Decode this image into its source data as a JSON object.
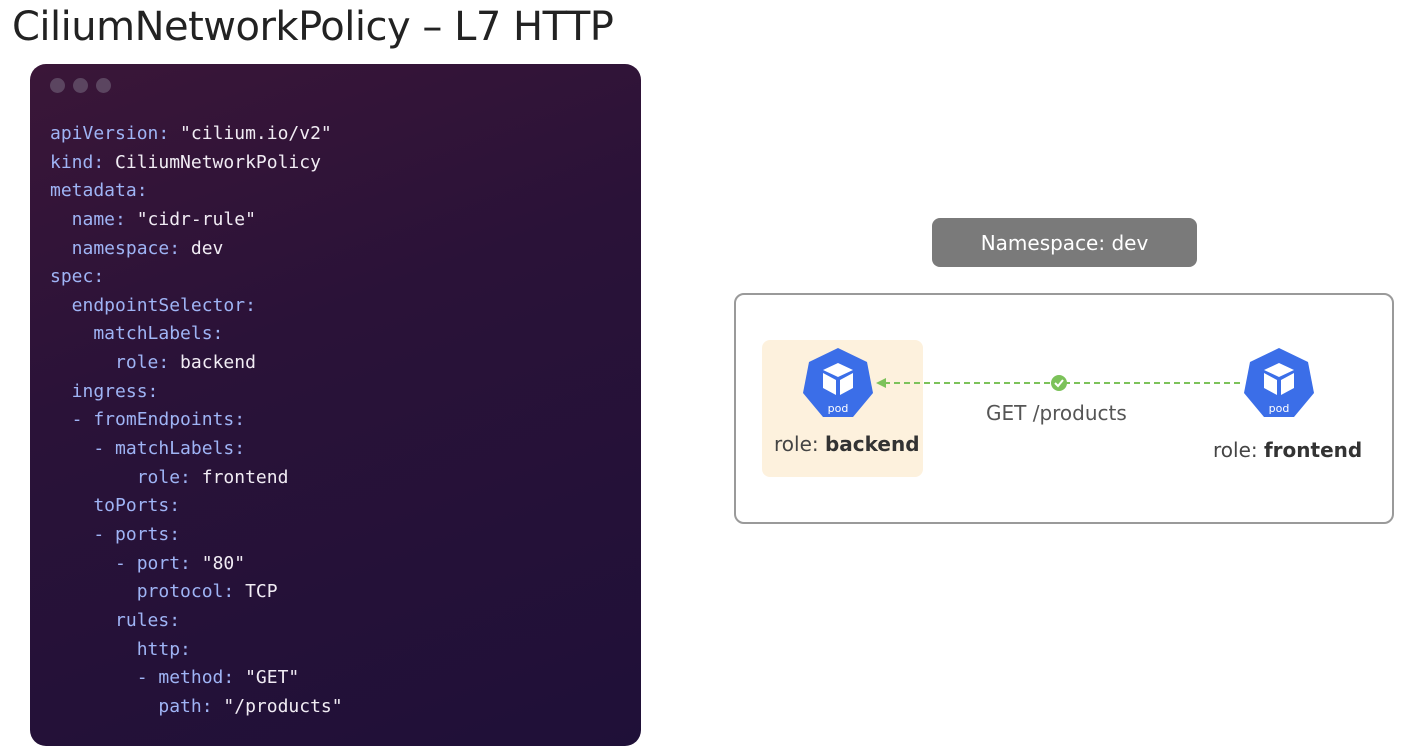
{
  "slide": {
    "title": "CiliumNetworkPolicy – L7 HTTP"
  },
  "code_window": {
    "lines": [
      {
        "key": "apiVersion:",
        "value": " \"cilium.io/v2\""
      },
      {
        "key": "kind:",
        "value": " CiliumNetworkPolicy"
      },
      {
        "key": "metadata:",
        "value": ""
      },
      {
        "key": "  name:",
        "value": " \"cidr-rule\""
      },
      {
        "key": "  namespace:",
        "value": " dev"
      },
      {
        "key": "spec:",
        "value": ""
      },
      {
        "key": "  endpointSelector:",
        "value": ""
      },
      {
        "key": "    matchLabels:",
        "value": ""
      },
      {
        "key": "      role:",
        "value": " backend"
      },
      {
        "key": "  ingress:",
        "value": ""
      },
      {
        "key": "  - fromEndpoints:",
        "value": ""
      },
      {
        "key": "    - matchLabels:",
        "value": ""
      },
      {
        "key": "        role:",
        "value": " frontend"
      },
      {
        "key": "    toPorts:",
        "value": ""
      },
      {
        "key": "    - ports:",
        "value": ""
      },
      {
        "key": "      - port:",
        "value": " \"80\""
      },
      {
        "key": "        protocol:",
        "value": " TCP"
      },
      {
        "key": "      rules:",
        "value": ""
      },
      {
        "key": "        http:",
        "value": ""
      },
      {
        "key": "        - method:",
        "value": " \"GET\""
      },
      {
        "key": "          path:",
        "value": " \"/products\""
      }
    ]
  },
  "diagram": {
    "namespace_label": "Namespace: dev",
    "backend": {
      "pod_label": "pod",
      "role_prefix": "role: ",
      "role_value": "backend",
      "icon": "kubernetes-pod-icon"
    },
    "frontend": {
      "pod_label": "pod",
      "role_prefix": "role: ",
      "role_value": "frontend",
      "icon": "kubernetes-pod-icon"
    },
    "edge_label": "GET /products",
    "colors": {
      "pod_blue": "#3b6ee8",
      "edge_green": "#7cc25a",
      "highlight": "#fdf1dd",
      "namespace_gray": "#7a7a7a"
    }
  }
}
